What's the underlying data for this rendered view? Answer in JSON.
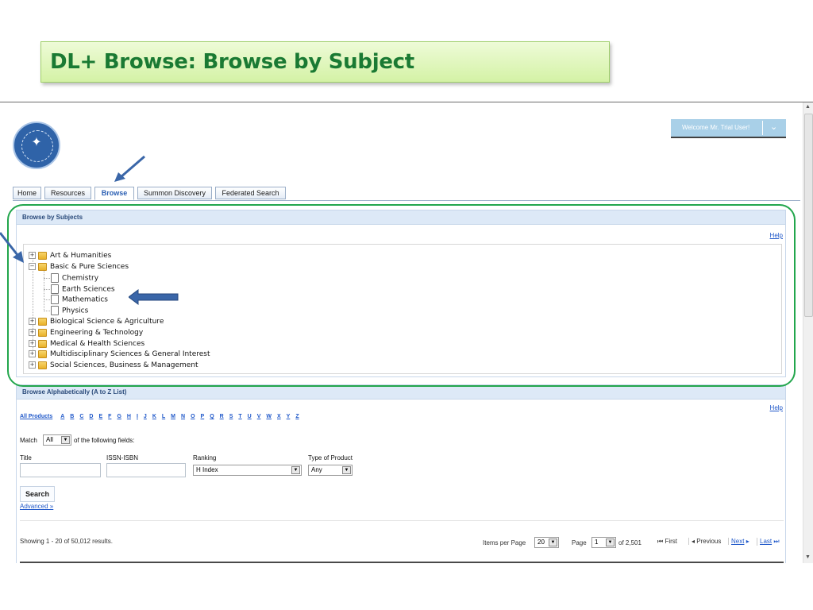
{
  "slide": {
    "title": "DL+ Browse: Browse by Subject"
  },
  "header": {
    "welcome": "Welcome Mr. Trial User!"
  },
  "tabs": [
    {
      "label": "Home"
    },
    {
      "label": "Resources"
    },
    {
      "label": "Browse"
    },
    {
      "label": "Summon Discovery"
    },
    {
      "label": "Federated Search"
    }
  ],
  "subjects": {
    "title": "Browse by Subjects",
    "help": "Help",
    "tree": [
      {
        "label": "Art & Humanities"
      },
      {
        "label": "Basic & Pure Sciences",
        "children": [
          {
            "label": "Chemistry"
          },
          {
            "label": "Earth Sciences"
          },
          {
            "label": "Mathematics"
          },
          {
            "label": "Physics"
          }
        ]
      },
      {
        "label": "Biological Science & Agriculture"
      },
      {
        "label": "Engineering & Technology"
      },
      {
        "label": "Medical & Health Sciences"
      },
      {
        "label": "Multidisciplinary Sciences & General Interest"
      },
      {
        "label": "Social Sciences, Business & Management"
      }
    ]
  },
  "alpha": {
    "title": "Browse Alphabetically (A to Z List)",
    "help": "Help",
    "all_products": "All Products",
    "letters": [
      "A",
      "B",
      "C",
      "D",
      "E",
      "F",
      "G",
      "H",
      "I",
      "J",
      "K",
      "L",
      "M",
      "N",
      "O",
      "P",
      "Q",
      "R",
      "S",
      "T",
      "U",
      "V",
      "W",
      "X",
      "Y",
      "Z"
    ],
    "match_label": "Match",
    "match_value": "All",
    "match_suffix": "of the following fields:",
    "fields": {
      "title": "Title",
      "issn": "ISSN-ISBN",
      "ranking": "Ranking",
      "ranking_value": "H Index",
      "type": "Type of Product",
      "type_value": "Any"
    },
    "search_button": "Search",
    "advanced": "Advanced »"
  },
  "results": {
    "showing": "Showing 1 - 20 of 50,012 results.",
    "items_per_page_label": "Items per Page",
    "items_per_page": "20",
    "page_label": "Page",
    "page": "1",
    "of_pages": "of 2,501",
    "first": "First",
    "previous": "Previous",
    "next": "Next",
    "last": "Last"
  },
  "colors": {
    "accent": "#22a64c",
    "title_text": "#1a7a33",
    "link": "#1e57c9",
    "arrow": "#3a66a8"
  }
}
